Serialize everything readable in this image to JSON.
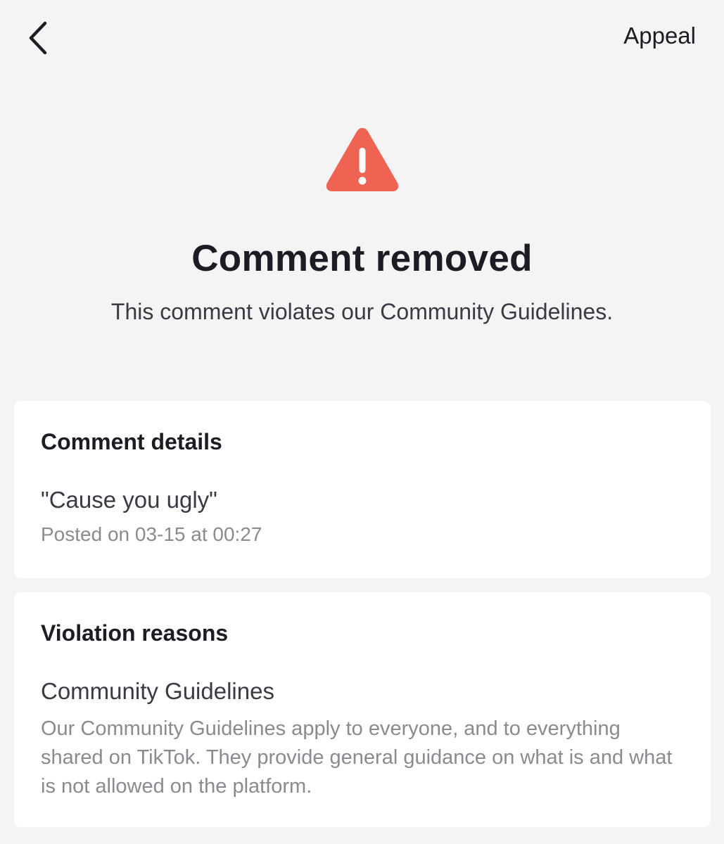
{
  "header": {
    "back_icon": "chevron-left-icon",
    "appeal_label": "Appeal"
  },
  "hero": {
    "icon": "warning-triangle-icon",
    "icon_color": "#ee6352",
    "title": "Comment removed",
    "subtitle": "This comment violates our Community Guidelines."
  },
  "comment_details": {
    "heading": "Comment details",
    "comment": "\"Cause you ugly\"",
    "posted": "Posted on 03-15 at 00:27"
  },
  "violation": {
    "heading": "Violation reasons",
    "reason_title": "Community Guidelines",
    "reason_description": "Our Community Guidelines apply to everyone, and to everything shared on TikTok. They provide general guidance on what is and what is not allowed on the platform."
  }
}
